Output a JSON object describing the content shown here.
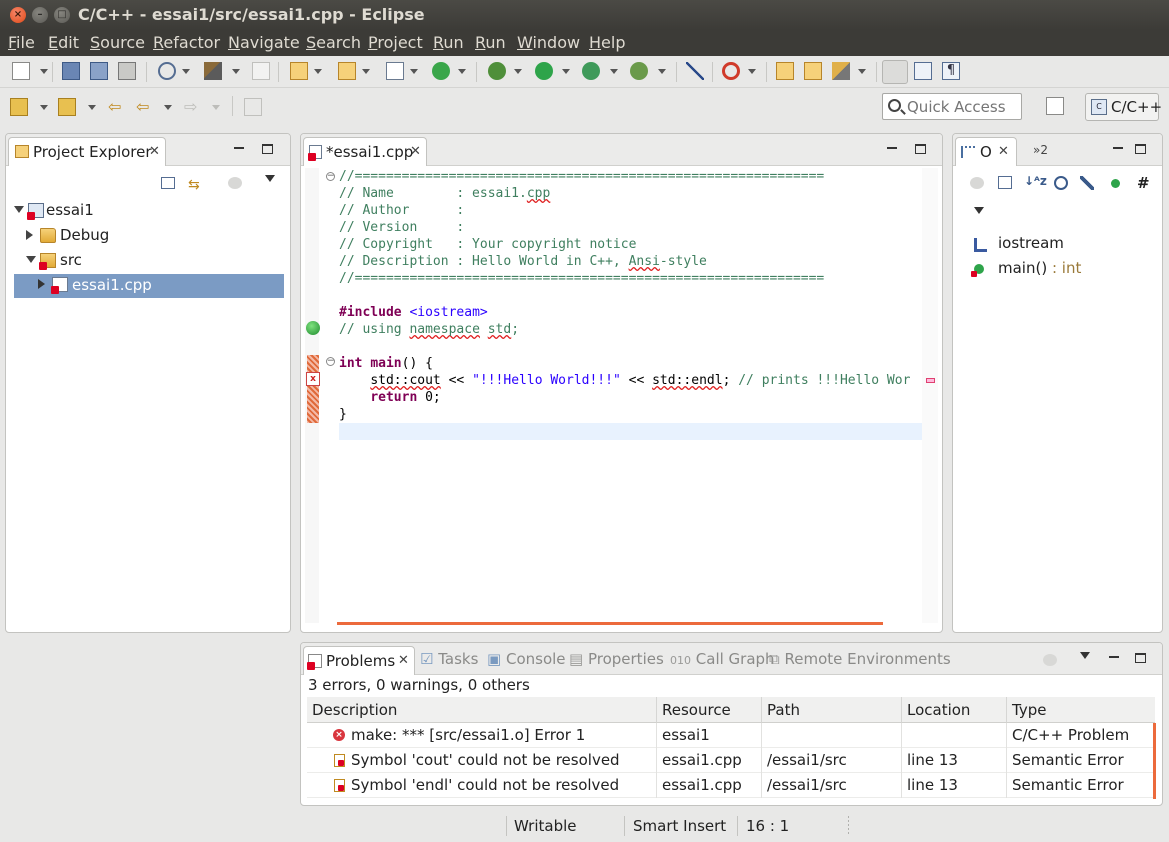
{
  "window": {
    "title": "C/C++ - essai1/src/essai1.cpp - Eclipse"
  },
  "menu": [
    "File",
    "Edit",
    "Source",
    "Refactor",
    "Navigate",
    "Search",
    "Project",
    "Run",
    "Run",
    "Window",
    "Help"
  ],
  "toolbar": {
    "quick_access_placeholder": "Quick Access",
    "perspective_label": "C/C++"
  },
  "project_explorer": {
    "tab_label": "Project Explorer",
    "tree": [
      {
        "label": "essai1",
        "level": 0,
        "expanded": true,
        "icon": "project-icon"
      },
      {
        "label": "Debug",
        "level": 1,
        "expanded": false,
        "icon": "folder-icon"
      },
      {
        "label": "src",
        "level": 1,
        "expanded": true,
        "icon": "source-folder-icon"
      },
      {
        "label": "essai1.cpp",
        "level": 2,
        "expanded": false,
        "selected": true,
        "icon": "cpp-file-icon"
      }
    ]
  },
  "editor": {
    "tab_label": "*essai1.cpp",
    "lines": [
      {
        "parts": [
          {
            "t": "//============================================================",
            "c": "c-com"
          }
        ]
      },
      {
        "parts": [
          {
            "t": "// Name        : essai1.",
            "c": "c-com"
          },
          {
            "t": "cpp",
            "c": "c-com sq"
          }
        ]
      },
      {
        "parts": [
          {
            "t": "// Author      :",
            "c": "c-com"
          }
        ]
      },
      {
        "parts": [
          {
            "t": "// Version     :",
            "c": "c-com"
          }
        ]
      },
      {
        "parts": [
          {
            "t": "// Copyright   : Your copyright notice",
            "c": "c-com"
          }
        ]
      },
      {
        "parts": [
          {
            "t": "// Description : Hello World in C++, ",
            "c": "c-com"
          },
          {
            "t": "Ansi",
            "c": "c-com sq"
          },
          {
            "t": "-style",
            "c": "c-com"
          }
        ]
      },
      {
        "parts": [
          {
            "t": "//============================================================",
            "c": "c-com"
          }
        ]
      },
      {
        "parts": []
      },
      {
        "parts": [
          {
            "t": "#include",
            "c": "c-kw"
          },
          {
            "t": " <iostream>",
            "c": "c-inc"
          }
        ]
      },
      {
        "parts": [
          {
            "t": "// using ",
            "c": "c-com"
          },
          {
            "t": "namespace",
            "c": "c-com sq"
          },
          {
            "t": " ",
            "c": "c-com"
          },
          {
            "t": "std",
            "c": "c-com sq"
          },
          {
            "t": ";",
            "c": "c-com"
          }
        ]
      },
      {
        "parts": []
      },
      {
        "parts": [
          {
            "t": "int",
            "c": "c-kw"
          },
          {
            "t": " ",
            "c": "c-def"
          },
          {
            "t": "main",
            "c": "c-kw"
          },
          {
            "t": "() {",
            "c": "c-def"
          }
        ]
      },
      {
        "parts": [
          {
            "t": "    ",
            "c": "c-def"
          },
          {
            "t": "std::cout",
            "c": "c-def sq"
          },
          {
            "t": " << ",
            "c": "c-def"
          },
          {
            "t": "\"!!!Hello World!!!\"",
            "c": "c-str"
          },
          {
            "t": " << ",
            "c": "c-def"
          },
          {
            "t": "std::endl",
            "c": "c-def sq"
          },
          {
            "t": "; ",
            "c": "c-def"
          },
          {
            "t": "// prints !!!Hello Wor",
            "c": "c-com"
          }
        ]
      },
      {
        "parts": [
          {
            "t": "    ",
            "c": "c-def"
          },
          {
            "t": "return",
            "c": "c-kw"
          },
          {
            "t": " 0;",
            "c": "c-def"
          }
        ]
      },
      {
        "parts": [
          {
            "t": "}",
            "c": "c-def"
          }
        ]
      }
    ]
  },
  "outline": {
    "tab_label": "O",
    "overflow_label": "»2",
    "items": [
      {
        "label": "iostream",
        "type": "",
        "icon": "include-icon"
      },
      {
        "label": "main()",
        "type": " : int",
        "icon": "function-icon"
      }
    ]
  },
  "bottom_tabs": [
    "Problems",
    "Tasks",
    "Console",
    "Properties",
    "Call Graph",
    "Remote Environments"
  ],
  "problems": {
    "summary": "3 errors, 0 warnings, 0 others",
    "columns": [
      "Description",
      "Resource",
      "Path",
      "Location",
      "Type"
    ],
    "rows": [
      {
        "description": "make: *** [src/essai1.o] Error 1",
        "resource": "essai1",
        "path": "",
        "location": "",
        "type": "C/C++ Problem",
        "icon": "error-icon"
      },
      {
        "description": "Symbol 'cout' could not be resolved",
        "resource": "essai1.cpp",
        "path": "/essai1/src",
        "location": "line 13",
        "type": "Semantic Error",
        "icon": "semantic-error-icon"
      },
      {
        "description": "Symbol 'endl' could not be resolved",
        "resource": "essai1.cpp",
        "path": "/essai1/src",
        "location": "line 13",
        "type": "Semantic Error",
        "icon": "semantic-error-icon"
      }
    ]
  },
  "status": {
    "writable": "Writable",
    "insert_mode": "Smart Insert",
    "position": "16 : 1"
  },
  "colors": {
    "accent_orange": "#ec6a3c",
    "selection": "#7b9bc4",
    "error_red": "#d02020"
  }
}
